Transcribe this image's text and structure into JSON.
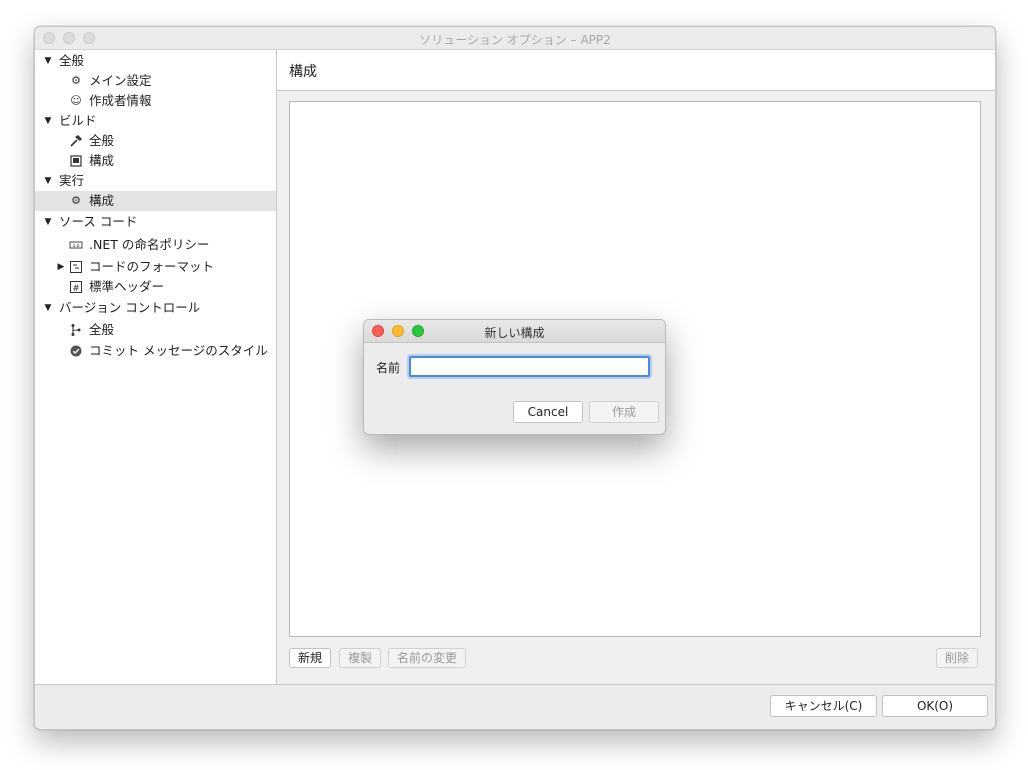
{
  "window": {
    "title": "ソリューション オプション – APP2"
  },
  "sidebar": {
    "categories": [
      {
        "label": "全般",
        "items": [
          {
            "label": "メイン設定",
            "icon": "gear-icon"
          },
          {
            "label": "作成者情報",
            "icon": "smiley-icon"
          }
        ]
      },
      {
        "label": "ビルド",
        "items": [
          {
            "label": "全般",
            "icon": "hammer-icon"
          },
          {
            "label": "構成",
            "icon": "document-icon"
          }
        ]
      },
      {
        "label": "実行",
        "items": [
          {
            "label": "構成",
            "icon": "gear-icon",
            "selected": true
          }
        ]
      },
      {
        "label": "ソース コード",
        "items": [
          {
            "label": ".NET の命名ポリシー",
            "icon": "naming-icon"
          },
          {
            "label": "コードのフォーマット",
            "icon": "format-icon",
            "collapsed": true
          },
          {
            "label": "標準ヘッダー",
            "icon": "hash-icon"
          }
        ]
      },
      {
        "label": "バージョン コントロール",
        "items": [
          {
            "label": "全般",
            "icon": "branch-icon"
          },
          {
            "label": "コミット メッセージのスタイル",
            "icon": "check-circle-icon"
          }
        ]
      }
    ]
  },
  "main": {
    "title": "構成",
    "buttons": {
      "new": "新規",
      "duplicate": "複製",
      "rename": "名前の変更",
      "delete": "削除"
    }
  },
  "footer": {
    "cancel": "キャンセル(C)",
    "ok": "OK(O)"
  },
  "dialog": {
    "title": "新しい構成",
    "name_label": "名前",
    "name_value": "",
    "cancel": "Cancel",
    "create": "作成"
  }
}
